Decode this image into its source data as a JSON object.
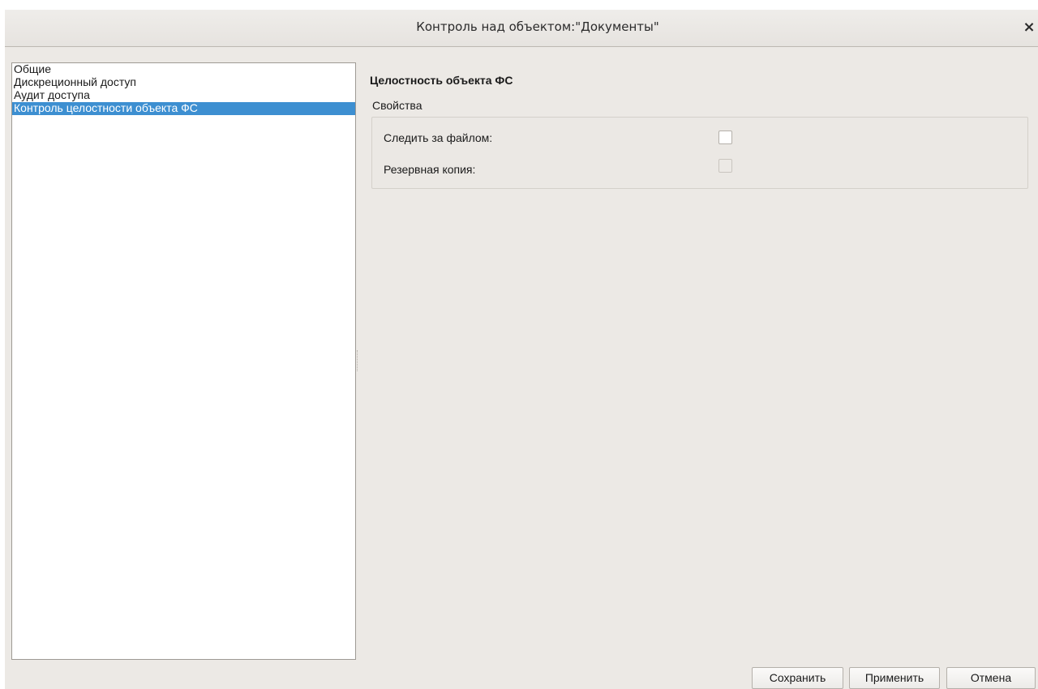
{
  "window": {
    "title": "Контроль над объектом:\"Документы\"",
    "close_glyph": "×"
  },
  "nav": {
    "items": [
      {
        "label": "Общие",
        "selected": false
      },
      {
        "label": "Дискреционный доступ",
        "selected": false
      },
      {
        "label": "Аудит доступа",
        "selected": false
      },
      {
        "label": "Контроль целостности объекта ФС",
        "selected": true
      }
    ]
  },
  "panel": {
    "section_title": "Целостность объекта ФС",
    "group_label": "Свойства",
    "rows": [
      {
        "label": "Следить за файлом:",
        "checked": false,
        "enabled": true
      },
      {
        "label": "Резервная копия:",
        "checked": false,
        "enabled": false
      }
    ]
  },
  "buttons": {
    "save": "Сохранить",
    "apply": "Применить",
    "cancel": "Отмена"
  },
  "colors": {
    "selection": "#3d8fd1",
    "window_bg": "#ece9e5"
  }
}
